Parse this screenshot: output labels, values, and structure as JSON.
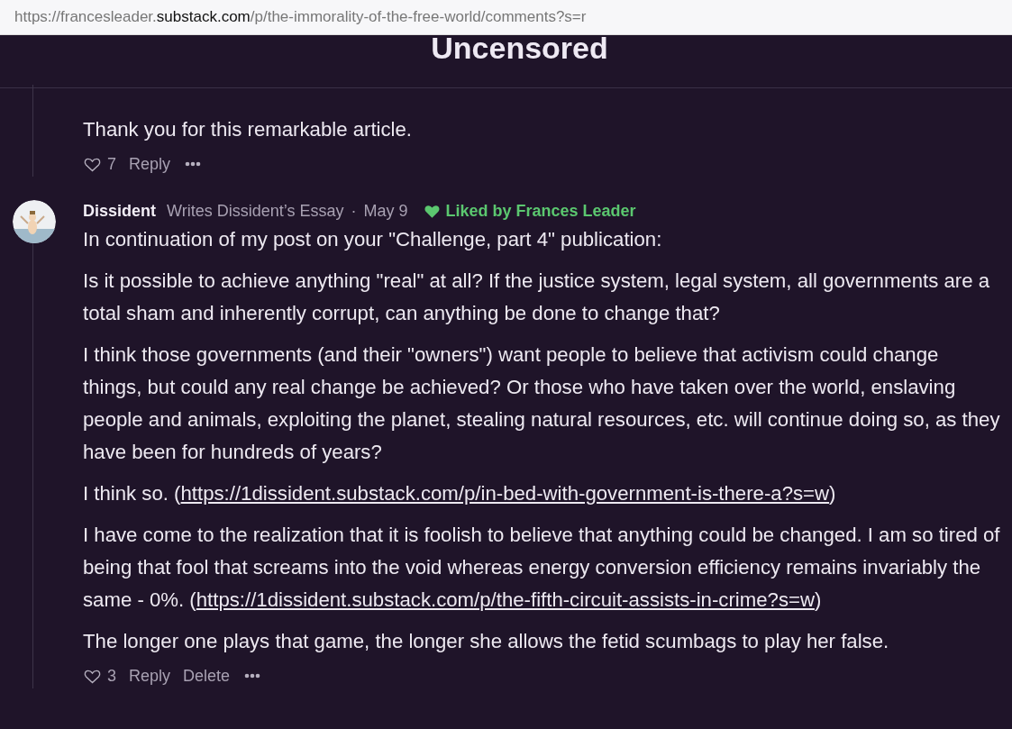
{
  "address_bar": {
    "url_parts": [
      {
        "text": "https://francesleader.",
        "kind": "dim"
      },
      {
        "text": "substack.com",
        "kind": "domain"
      },
      {
        "text": "/p/the-immorality-of-the-free-world/comments?s=r",
        "kind": "dim"
      }
    ]
  },
  "header": {
    "title": "Uncensored"
  },
  "comments": [
    {
      "paragraphs": [
        [
          {
            "kind": "text",
            "text": "Thank you for this remarkable article."
          }
        ]
      ],
      "likes": "7",
      "actions": [
        "Reply"
      ]
    },
    {
      "author": "Dissident",
      "subtitle": "Writes Dissident’s Essay",
      "separator": "·",
      "date": "May 9",
      "liked_by": "Liked by Frances Leader",
      "paragraphs": [
        [
          {
            "kind": "text",
            "text": "In continuation of my post on your \"Challenge, part 4\" publication:"
          }
        ],
        [
          {
            "kind": "text",
            "text": "Is it possible to achieve anything \"real\" at all? If the justice system, legal system, all governments are a total sham and inherently corrupt, can anything be done to change that?"
          }
        ],
        [
          {
            "kind": "text",
            "text": "I think those governments (and their \"owners\") want people to believe that activism could change things, but could any real change be achieved? Or those who have taken over the world, enslaving people and animals, exploiting the planet, stealing natural resources, etc. will continue doing so, as they have been for hundreds of years?"
          }
        ],
        [
          {
            "kind": "text",
            "text": "I think so. ("
          },
          {
            "kind": "link",
            "text": "https://1dissident.substack.com/p/in-bed-with-government-is-there-a?s=w"
          },
          {
            "kind": "text",
            "text": ")"
          }
        ],
        [
          {
            "kind": "text",
            "text": "I have come to the realization that it is foolish to believe that anything could be changed. I am so tired of being that fool that screams into the void whereas energy conversion efficiency remains invariably the same - 0%. ("
          },
          {
            "kind": "link",
            "text": "https://1dissident.substack.com/p/the-fifth-circuit-assists-in-crime?s=w"
          },
          {
            "kind": "text",
            "text": ")"
          }
        ],
        [
          {
            "kind": "text",
            "text": "The longer one plays that game, the longer she allows the fetid scumbags to play her false."
          }
        ]
      ],
      "likes": "3",
      "actions": [
        "Reply",
        "Delete"
      ]
    }
  ]
}
